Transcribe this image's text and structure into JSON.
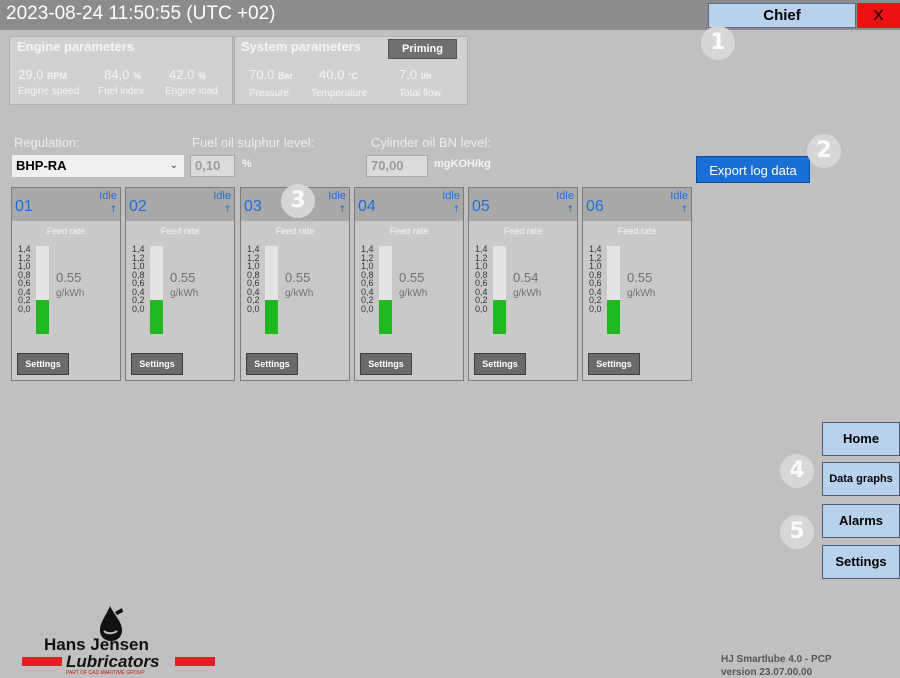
{
  "header": {
    "datetime": "2023-08-24 11:50:55 (UTC +02)",
    "user": "Chief",
    "close_label": "X"
  },
  "callouts": [
    "1",
    "2",
    "3",
    "4",
    "5"
  ],
  "engine_params": {
    "title": "Engine parameters",
    "items": [
      {
        "value": "29,0",
        "unit": "RPM",
        "label": "Engine speed"
      },
      {
        "value": "84,0",
        "unit": "%",
        "label": "Fuel index"
      },
      {
        "value": "42,0",
        "unit": "%",
        "label": "Engine load"
      }
    ]
  },
  "system_params": {
    "title": "System parameters",
    "priming_label": "Priming",
    "items": [
      {
        "value": "70,0",
        "unit": "Bar",
        "label": "Pressure"
      },
      {
        "value": "40,0",
        "unit": "°C",
        "label": "Temperature"
      },
      {
        "value": "7,0",
        "unit": "l/h",
        "label": "Total flow"
      }
    ]
  },
  "regulation": {
    "label": "Regulation:",
    "value": "BHP-RA"
  },
  "sulphur": {
    "label": "Fuel oil sulphur level:",
    "value": "0,10",
    "unit": "%"
  },
  "bn": {
    "label": "Cylinder oil BN level:",
    "value": "70,00",
    "unit": "mgKOH/kg"
  },
  "export_label": "Export log data",
  "cylinders": [
    {
      "no": "01",
      "state": "Idle",
      "arrow": "↑",
      "feed_label": "Feed rate",
      "rate": "0.55",
      "unit": "g/kWh",
      "fill_fraction": 0.39,
      "settings_label": "Settings"
    },
    {
      "no": "02",
      "state": "Idle",
      "arrow": "↑",
      "feed_label": "Feed rate",
      "rate": "0.55",
      "unit": "g/kWh",
      "fill_fraction": 0.39,
      "settings_label": "Settings"
    },
    {
      "no": "03",
      "state": "Idle",
      "arrow": "↑",
      "feed_label": "Feed rate",
      "rate": "0.55",
      "unit": "g/kWh",
      "fill_fraction": 0.39,
      "settings_label": "Settings"
    },
    {
      "no": "04",
      "state": "Idle",
      "arrow": "↑",
      "feed_label": "Feed rate",
      "rate": "0.55",
      "unit": "g/kWh",
      "fill_fraction": 0.39,
      "settings_label": "Settings"
    },
    {
      "no": "05",
      "state": "Idle",
      "arrow": "↑",
      "feed_label": "Feed rate",
      "rate": "0.54",
      "unit": "g/kWh",
      "fill_fraction": 0.385,
      "settings_label": "Settings"
    },
    {
      "no": "06",
      "state": "Idle",
      "arrow": "↑",
      "feed_label": "Feed rate",
      "rate": "0.55",
      "unit": "g/kWh",
      "fill_fraction": 0.39,
      "settings_label": "Settings"
    }
  ],
  "scale_ticks": [
    "1,4",
    "1,2",
    "1,0",
    "0,8",
    "0,6",
    "0,4",
    "0,2",
    "0,0"
  ],
  "nav": {
    "home": "Home",
    "data_graphs": "Data graphs",
    "alarms": "Alarms",
    "settings": "Settings"
  },
  "footer": {
    "logo_line1": "Hans    Jensen",
    "logo_line2": "Lubricators",
    "logo_tag": "PART OF CAD MARITIME GROUP",
    "version_line1": "HJ Smartlube 4.0 - PCP",
    "version_line2": "version 23.07.00.00"
  },
  "colors": {
    "background": "#c0c0c0",
    "header": "#8c8c8c",
    "nav_button": "#b8d2ec",
    "accent_blue": "#1f6ed8",
    "export_blue": "#1a6fd4",
    "feed_green": "#20b820",
    "close_red": "#ee1111",
    "logo_red": "#e31e24"
  }
}
